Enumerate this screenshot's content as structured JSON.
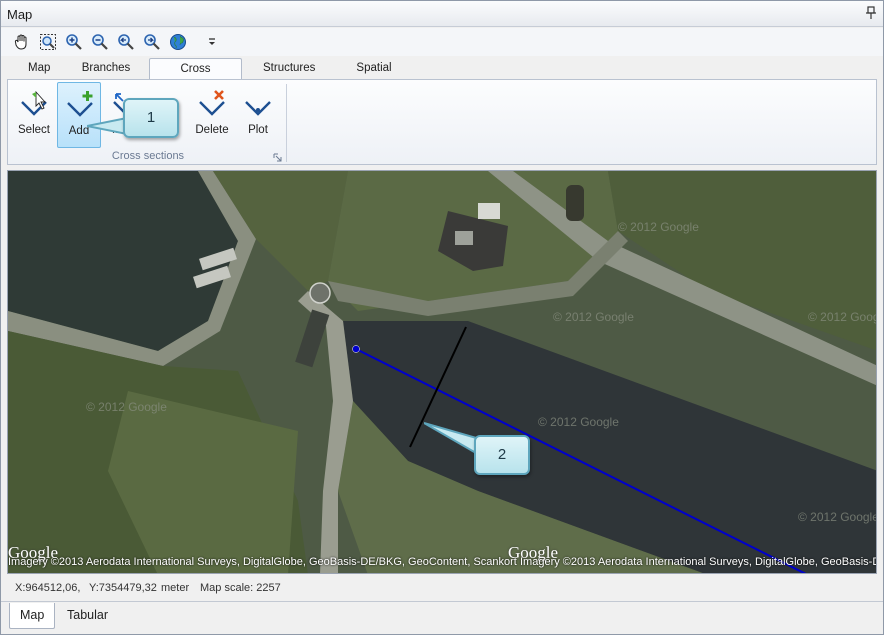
{
  "window": {
    "title": "Map"
  },
  "toolbar": {
    "icons": [
      "pan-hand-icon",
      "zoom-rectangle-icon",
      "zoom-in-icon",
      "zoom-out-icon",
      "zoom-previous-icon",
      "zoom-next-icon",
      "globe-icon",
      "overflow-icon"
    ]
  },
  "tabs": [
    {
      "label": "Map"
    },
    {
      "label": "Branches"
    },
    {
      "label": "Cross sections",
      "active": true
    },
    {
      "label": "Structures"
    },
    {
      "label": "Spatial data"
    }
  ],
  "ribbon": {
    "group_label": "Cross sections",
    "buttons": {
      "select": "Select",
      "add": "Add",
      "move": "Move",
      "delete": "Delete",
      "plot": "Plot"
    }
  },
  "map": {
    "google_logo": "Google",
    "attribution": "Imagery ©2013 Aerodata International Surveys, DigitalGlobe, GeoBasis-DE/BKG, GeoContent, Scankort",
    "branch_color": "#0000cc",
    "cross_section_color": "#000000"
  },
  "callouts": {
    "one": "1",
    "two": "2"
  },
  "status": {
    "x": "X:964512,06,",
    "y": "Y:7354479,32",
    "unit": "meter",
    "scale": "Map scale: 2257"
  },
  "bottom_tabs": [
    {
      "label": "Map",
      "active": true
    },
    {
      "label": "Tabular"
    }
  ],
  "colors": {
    "accent_active": "#b8e1fa",
    "callout_fill": "#c8eaf1",
    "callout_border": "#5ea6bd"
  }
}
